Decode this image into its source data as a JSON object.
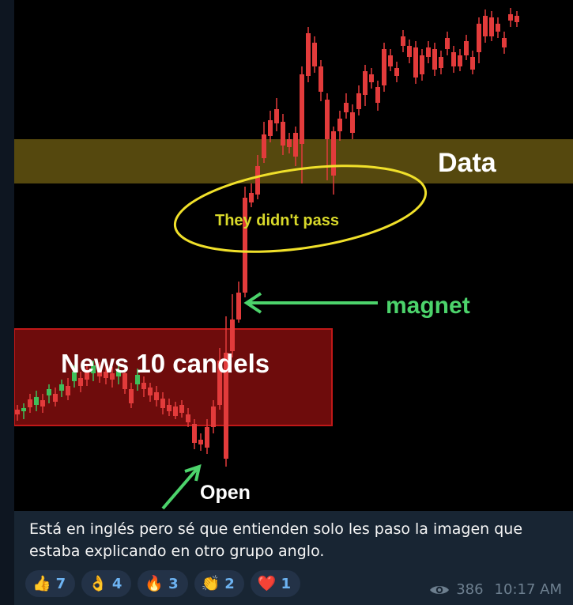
{
  "chart_image": {
    "zones": [
      {
        "label": "Data",
        "color": "#6a5a12"
      },
      {
        "label": "News 10 candels",
        "color": "#7a0d0d"
      }
    ],
    "annotations": [
      {
        "text": "They didn't pass",
        "color": "#d9d92a"
      },
      {
        "text": "magnet",
        "color": "#4cd36b"
      },
      {
        "text": "Open",
        "color": "#ffffff"
      }
    ]
  },
  "message": {
    "text": "Está en inglés pero sé que entienden solo les paso la imagen que estaba explicando en otro grupo anglo."
  },
  "reactions": [
    {
      "emoji": "👍",
      "icon": "thumbs-up",
      "count": "7"
    },
    {
      "emoji": "👌",
      "icon": "ok-hand",
      "count": "4"
    },
    {
      "emoji": "🔥",
      "icon": "fire",
      "count": "3"
    },
    {
      "emoji": "👏",
      "icon": "clapping-hands",
      "count": "2"
    },
    {
      "emoji": "❤️",
      "icon": "red-heart",
      "count": "1"
    }
  ],
  "meta": {
    "views": "386",
    "time": "10:17 AM"
  }
}
